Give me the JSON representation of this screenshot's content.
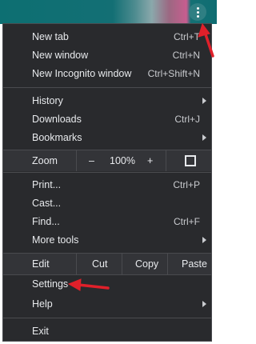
{
  "icons": {
    "menu": "vertical-ellipsis-icon",
    "fullscreen": "fullscreen-icon",
    "submenu": "chevron-right-icon",
    "annotation": "red-arrow"
  },
  "colors": {
    "menu_bg": "#292a2d",
    "row_bg": "#333438",
    "text": "#e8eaed",
    "annotation": "#e0202a"
  },
  "menu": {
    "new_tab": {
      "label": "New tab",
      "shortcut": "Ctrl+T"
    },
    "new_window": {
      "label": "New window",
      "shortcut": "Ctrl+N"
    },
    "new_incognito": {
      "label": "New Incognito window",
      "shortcut": "Ctrl+Shift+N"
    },
    "history": {
      "label": "History"
    },
    "downloads": {
      "label": "Downloads",
      "shortcut": "Ctrl+J"
    },
    "bookmarks": {
      "label": "Bookmarks"
    },
    "zoom": {
      "label": "Zoom",
      "minus": "–",
      "level": "100%",
      "plus": "+"
    },
    "print": {
      "label": "Print...",
      "shortcut": "Ctrl+P"
    },
    "cast": {
      "label": "Cast..."
    },
    "find": {
      "label": "Find...",
      "shortcut": "Ctrl+F"
    },
    "more_tools": {
      "label": "More tools"
    },
    "edit": {
      "label": "Edit",
      "cut": "Cut",
      "copy": "Copy",
      "paste": "Paste"
    },
    "settings": {
      "label": "Settings"
    },
    "help": {
      "label": "Help"
    },
    "exit": {
      "label": "Exit"
    }
  }
}
